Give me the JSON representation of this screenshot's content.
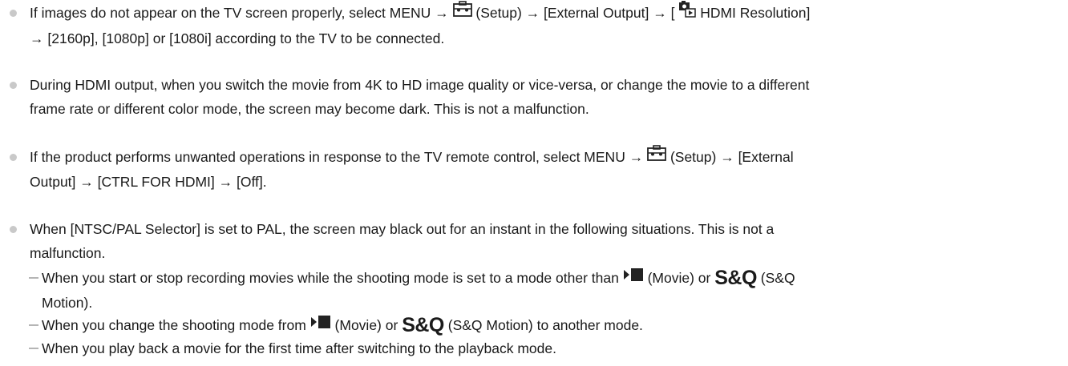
{
  "notes": {
    "hdmi_resolution": {
      "line1_a": "If images do not appear on the TV screen properly, select MENU →",
      "line1_b": "(Setup) → [External Output] → [",
      "line1_c": "HDMI Resolution]",
      "line2": "→ [2160p], [1080p] or [1080i] according to the TV to be connected."
    },
    "hdmi_output": {
      "line1": "During HDMI output, when you switch the movie from 4K to HD image quality or vice-versa, or change the movie to a different",
      "line2": "frame rate or different color mode, the screen may become dark. This is not a malfunction."
    },
    "tv_remote": {
      "line1_a": "If the product performs unwanted operations in response to the TV remote control, select MENU →",
      "line1_b": "(Setup) → [External",
      "line2": "Output] → [CTRL FOR HDMI] → [Off]."
    },
    "ntsc_pal": {
      "line1": "When [NTSC/PAL Selector] is set to PAL, the screen may black out for an instant in the following situations. This is not a",
      "line2": "malfunction.",
      "sub1_a": "When you start or stop recording movies while the shooting mode is set to a mode other than",
      "sub1_b": "(Movie) or",
      "sub1_c": "(S&Q",
      "sub1_line2": "Motion).",
      "sub2_a": "When you change the shooting mode from",
      "sub2_b": "(Movie) or",
      "sub2_c": "(S&Q Motion) to another mode.",
      "sub3": "When you play back a movie for the first time after switching to the playback mode."
    }
  },
  "icons": {
    "setup": "setup-toolbox-icon",
    "movie_photo": "movie-photo-icon",
    "movie_mode": "movie-mode-icon",
    "sq_label": "S&Q"
  }
}
